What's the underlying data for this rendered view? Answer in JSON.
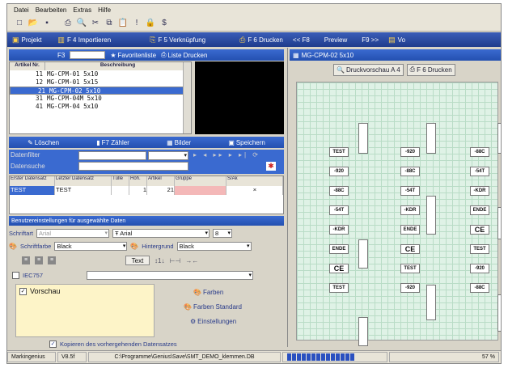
{
  "menu": [
    "Datei",
    "Bearbeiten",
    "Extras",
    "Hilfe"
  ],
  "fbar": [
    {
      "label": "Projekt",
      "icon": "project-icon"
    },
    {
      "label": "F 4 Importieren",
      "icon": "import-icon"
    },
    {
      "label": "F 5 Verknüpfung",
      "icon": "link-icon"
    },
    {
      "label": "F 6 Drucken",
      "icon": "print-icon"
    },
    {
      "label": "<< F8",
      "icon": ""
    },
    {
      "label": "Preview",
      "icon": ""
    },
    {
      "label": "F9 >>",
      "icon": ""
    },
    {
      "label": "Vo",
      "icon": "view-icon"
    }
  ],
  "search": {
    "f3": "F3",
    "fav": "Favoritenliste",
    "list_print": "Liste Drucken"
  },
  "artlist": {
    "headers": [
      "Artikel Nr.",
      "Beschreibung"
    ],
    "rows": [
      {
        "nr": "11",
        "desc": "MG-CPM-01 5x10"
      },
      {
        "nr": "12",
        "desc": "MG-CPM-01 5x15"
      },
      {
        "nr": "21",
        "desc": "MG-CPM-02 5x10"
      },
      {
        "nr": "31",
        "desc": "MG-CPM-04M 5x10"
      },
      {
        "nr": "41",
        "desc": "MG-CPM-04 5x10"
      }
    ],
    "selected": 2
  },
  "actions": [
    "Löschen",
    "F7 Zähler",
    "Bilder",
    "Speichern"
  ],
  "filter": {
    "datenfilter": "Datenfilter",
    "datensuche": "Datensuche"
  },
  "dsgrid": {
    "headers": [
      "Erster Datensatz",
      "Letzter Datensatz",
      "Tülle",
      "Höh.",
      "Artikel",
      "Gruppe",
      "S/Ak"
    ],
    "row": [
      "TEST",
      "TEST",
      "",
      "1",
      "21",
      "",
      "×"
    ]
  },
  "userset": "Benutzereinstellungen für ausgewählte Daten",
  "font": {
    "schriftart_label": "Schriftart",
    "font_hint": "Arial",
    "font_value": "Arial",
    "size": "8"
  },
  "colors": {
    "fg_label": "Schriftfarbe",
    "fg": "Black",
    "bg_label": "Hintergrund",
    "bg": "Black"
  },
  "text_btn": "Text",
  "iec_label": "IEC757",
  "vorschau_label": "Vorschau",
  "color_buttons": [
    "Farben",
    "Farben Standard",
    "Einstellungen"
  ],
  "kopieren": "Kopieren des vorhergehenden Datensatzes",
  "right": {
    "title": "MG-CPM-02 5x10",
    "preview_btn": "Druckvorschau A 4",
    "print_btn": "F 6 Drucken"
  },
  "sheet_cols": [
    [
      "TEST",
      "-920",
      "-88C",
      "-54T",
      "-KDR",
      "ENDE",
      "CE",
      "TEST"
    ],
    [
      "-920",
      "-88C",
      "-54T",
      "-KDR",
      "ENDE",
      "CE",
      "TEST",
      "-920"
    ],
    [
      "-88C",
      "-54T",
      "-KDR",
      "ENDE",
      "CE",
      "TEST",
      "-920",
      "-88C"
    ]
  ],
  "status": {
    "app": "Markingenius",
    "version": "V8.5f",
    "path": "C:\\Programme\\Genius\\Save\\SMT_DEMO_klemmen.DB",
    "zoom": "57 %",
    "progress_cells": 14
  },
  "colors_theme": {
    "accent": "#2450b0",
    "selection": "#3a6ad0",
    "sheet": "#dff2e6"
  }
}
